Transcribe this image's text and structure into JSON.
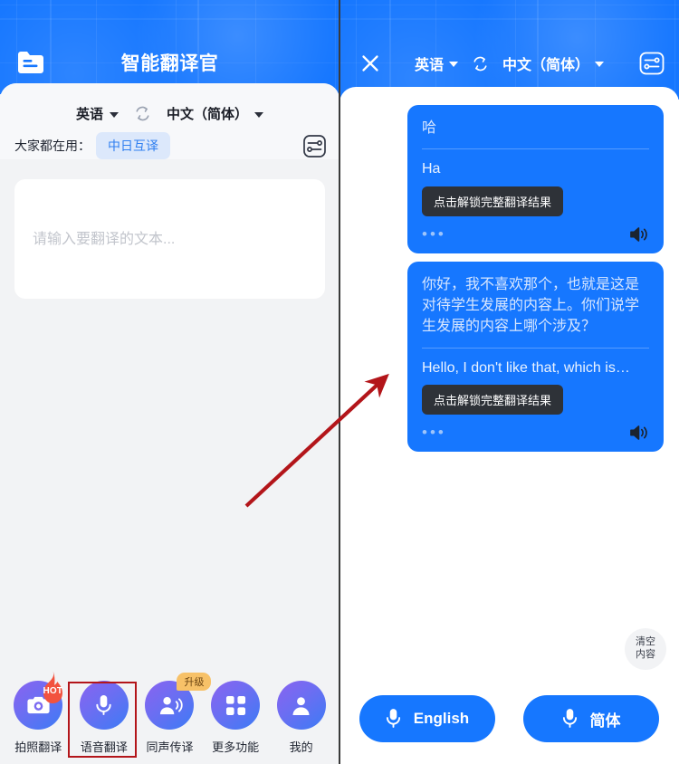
{
  "left": {
    "header": {
      "icon": "document-folder-icon",
      "title": "智能翻译官"
    },
    "lang_bar": {
      "source": "英语",
      "swap_icon": "swap-arrows-icon",
      "target": "中文（简体）"
    },
    "recommend": {
      "label": "大家都在用：",
      "chip": "中日互译",
      "settings_icon": "sliders-settings-icon"
    },
    "input": {
      "placeholder": "请输入要翻译的文本...",
      "value": ""
    },
    "nav": [
      {
        "label": "拍照翻译",
        "icon": "camera-icon",
        "badge": "HOT",
        "badge_type": "flame",
        "highlighted": false
      },
      {
        "label": "语音翻译",
        "icon": "microphone-icon",
        "badge": "",
        "badge_type": "none",
        "highlighted": true
      },
      {
        "label": "同声传译",
        "icon": "person-speaking-icon",
        "badge": "升级",
        "badge_type": "tag",
        "highlighted": false
      },
      {
        "label": "更多功能",
        "icon": "grid-apps-icon",
        "badge": "",
        "badge_type": "none",
        "highlighted": false
      },
      {
        "label": "我的",
        "icon": "user-profile-icon",
        "badge": "",
        "badge_type": "none",
        "highlighted": false
      }
    ]
  },
  "right": {
    "header": {
      "close_icon": "close-x-icon",
      "source": "英语",
      "swap_icon": "swap-arrows-icon",
      "target": "中文（简体）",
      "settings_icon": "sliders-settings-icon"
    },
    "messages": [
      {
        "source_text": "哈",
        "translated_text": "Ha",
        "unlock_label": "点击解锁完整翻译结果",
        "more_dots": "•••",
        "speaker_icon": "speaker-icon"
      },
      {
        "source_text": "你好，我不喜欢那个，也就是这是对待学生发展的内容上。你们说学生发展的内容上哪个涉及？",
        "translated_text": "Hello, I don't like that, which is…",
        "unlock_label": "点击解锁完整翻译结果",
        "more_dots": "•••",
        "speaker_icon": "speaker-icon"
      }
    ],
    "clear_button": {
      "line1": "清空",
      "line2": "内容"
    },
    "mic_buttons": [
      {
        "label": "English",
        "icon": "microphone-icon"
      },
      {
        "label": "简体",
        "icon": "microphone-icon"
      }
    ]
  },
  "annotation": {
    "arrow_color": "#b3151a",
    "highlight_color": "#b3151a"
  }
}
